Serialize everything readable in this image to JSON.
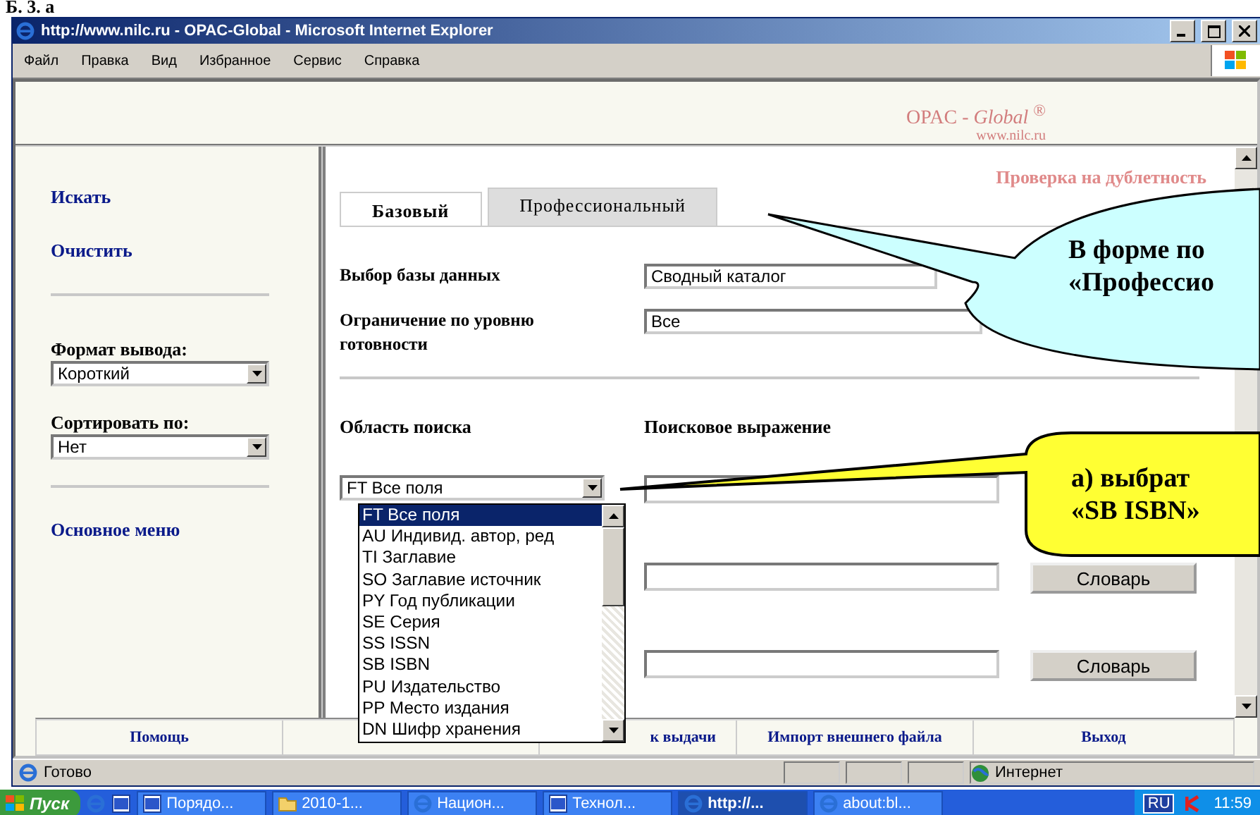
{
  "slide_heading": "Б. 3. а",
  "window": {
    "title": "http://www.nilc.ru - OPAC-Global - Microsoft Internet Explorer"
  },
  "menu": [
    "Файл",
    "Правка",
    "Вид",
    "Избранное",
    "Сервис",
    "Справка"
  ],
  "header": {
    "logo": "OPAC - *Global* $^{®}$",
    "site": "www.nilc.ru"
  },
  "sidebar": {
    "links": [
      "Искать",
      "Очистить"
    ],
    "format": {
      "label": "Формат вывода:",
      "value": "Короткий"
    },
    "sort": {
      "label": "Сортировать по:",
      "value": "Нет"
    },
    "main_menu": "Основное меню"
  },
  "tabs": [
    {
      "label": "Базовый",
      "selected": true
    },
    {
      "label": "Профессиональный",
      "selected": false
    }
  ],
  "duplicate_check": "Проверка на дублетность",
  "database": {
    "label": "Выбор базы данных",
    "value": "Сводный каталог"
  },
  "readiness": {
    "label": "Ограничение по уровню готовности",
    "value": "Все"
  },
  "search": {
    "area_heading": "Область поиска",
    "expression_heading": "Поисковое выражение",
    "rows": [
      {
        "area": "FT Все поля"
      },
      {
        "button": "Словарь"
      },
      {
        "button": "Словарь"
      }
    ]
  },
  "dropdown": {
    "options": [
      {
        "label": "FT Все поля",
        "selected": true
      },
      {
        "label": "AU Индивид. автор, ред",
        "selected": false
      },
      {
        "label": "TI Заглавие",
        "selected": false
      },
      {
        "label": "SO Заглавие источник",
        "selected": false
      },
      {
        "label": "PY Год публикации",
        "selected": false
      },
      {
        "label": "SE Серия",
        "selected": false
      },
      {
        "label": "SS ISSN",
        "selected": false
      },
      {
        "label": "SB ISBN",
        "selected": false
      },
      {
        "label": "PU Издательство",
        "selected": false
      },
      {
        "label": "PP Место издания",
        "selected": false
      },
      {
        "label": "DN Шифр хранения",
        "selected": false
      }
    ]
  },
  "footer_links": [
    "Помощь",
    "к выдачи",
    "Импорт внешнего файла",
    "Выход"
  ],
  "callouts": [
    {
      "kind": "blue",
      "lines": [
        "В форме по",
        "«Профессио"
      ]
    },
    {
      "kind": "yellow",
      "lines": [
        "а) выбрат",
        "«SB ISBN»"
      ]
    }
  ],
  "status": {
    "text": "Готово",
    "zone": "Интернет"
  },
  "taskbar": {
    "start": "Пуск",
    "tasks": [
      {
        "label": "Порядо...",
        "kind": "word",
        "selected": false
      },
      {
        "label": "2010-1...",
        "kind": "folder",
        "selected": false
      },
      {
        "label": "Национ...",
        "kind": "ie",
        "selected": false
      },
      {
        "label": "Технол...",
        "kind": "word",
        "selected": false
      },
      {
        "label": "http://...",
        "kind": "ie",
        "selected": true
      },
      {
        "label": "about:bl...",
        "kind": "ie",
        "selected": false
      }
    ],
    "lang": "RU",
    "clock": "11:59"
  }
}
